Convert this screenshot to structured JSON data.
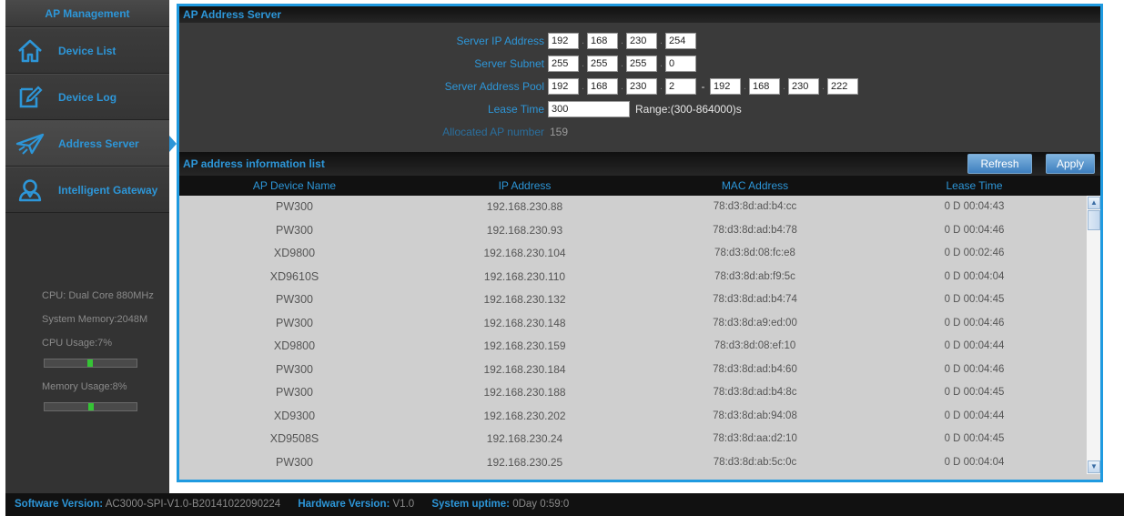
{
  "sidebar": {
    "title": "AP Management",
    "items": [
      {
        "label": "Device List",
        "icon": "home-icon"
      },
      {
        "label": "Device Log",
        "icon": "edit-icon"
      },
      {
        "label": "Address Server",
        "icon": "plane-icon"
      },
      {
        "label": "Intelligent Gateway",
        "icon": "user-icon"
      }
    ],
    "active_index": 2,
    "stats": {
      "cpu": "CPU: Dual Core 880MHz",
      "memory": "System Memory:2048M",
      "cpu_usage": "CPU Usage:7%",
      "cpu_usage_fraction": 0.07,
      "mem_usage": "Memory Usage:8%",
      "mem_usage_fraction": 0.08
    }
  },
  "server": {
    "header": "AP Address Server",
    "ip_label": "Server IP Address",
    "ip": [
      "192",
      "168",
      "230",
      "254"
    ],
    "subnet_label": "Server Subnet",
    "subnet": [
      "255",
      "255",
      "255",
      "0"
    ],
    "pool_label": "Server Address Pool",
    "pool_start": [
      "192",
      "168",
      "230",
      "2"
    ],
    "pool_sep": "-",
    "pool_end": [
      "192",
      "168",
      "230",
      "222"
    ],
    "lease_label": "Lease Time",
    "lease_value": "300",
    "lease_range": "Range:(300-864000)s",
    "alloc_label": "Allocated AP number",
    "alloc_value": "159"
  },
  "list": {
    "header": "AP address information list",
    "refresh_label": "Refresh",
    "apply_label": "Apply",
    "columns": [
      "AP Device Name",
      "IP Address",
      "MAC Address",
      "Lease Time"
    ],
    "rows": [
      [
        "PW300",
        "192.168.230.88",
        "78:d3:8d:ad:b4:cc",
        "0 D 00:04:43"
      ],
      [
        "PW300",
        "192.168.230.93",
        "78:d3:8d:ad:b4:78",
        "0 D 00:04:46"
      ],
      [
        "XD9800",
        "192.168.230.104",
        "78:d3:8d:08:fc:e8",
        "0 D 00:02:46"
      ],
      [
        "XD9610S",
        "192.168.230.110",
        "78:d3:8d:ab:f9:5c",
        "0 D 00:04:04"
      ],
      [
        "PW300",
        "192.168.230.132",
        "78:d3:8d:ad:b4:74",
        "0 D 00:04:45"
      ],
      [
        "PW300",
        "192.168.230.148",
        "78:d3:8d:a9:ed:00",
        "0 D 00:04:46"
      ],
      [
        "XD9800",
        "192.168.230.159",
        "78:d3:8d:08:ef:10",
        "0 D 00:04:44"
      ],
      [
        "PW300",
        "192.168.230.184",
        "78:d3:8d:ad:b4:60",
        "0 D 00:04:46"
      ],
      [
        "PW300",
        "192.168.230.188",
        "78:d3:8d:ad:b4:8c",
        "0 D 00:04:45"
      ],
      [
        "XD9300",
        "192.168.230.202",
        "78:d3:8d:ab:94:08",
        "0 D 00:04:44"
      ],
      [
        "XD9508S",
        "192.168.230.24",
        "78:d3:8d:aa:d2:10",
        "0 D 00:04:45"
      ],
      [
        "PW300",
        "192.168.230.25",
        "78:d3:8d:ab:5c:0c",
        "0 D 00:04:04"
      ]
    ]
  },
  "footer": {
    "sw_label": "Software Version:",
    "sw_value": "AC3000-SPI-V1.0-B20141022090224",
    "hw_label": "Hardware Version:",
    "hw_value": "V1.0",
    "uptime_label": "System uptime:",
    "uptime_value": "0Day 0:59:0"
  },
  "colors": {
    "accent": "#2d96d8",
    "frame_border": "#1f9ae0",
    "meter_fill": "#35c435"
  }
}
